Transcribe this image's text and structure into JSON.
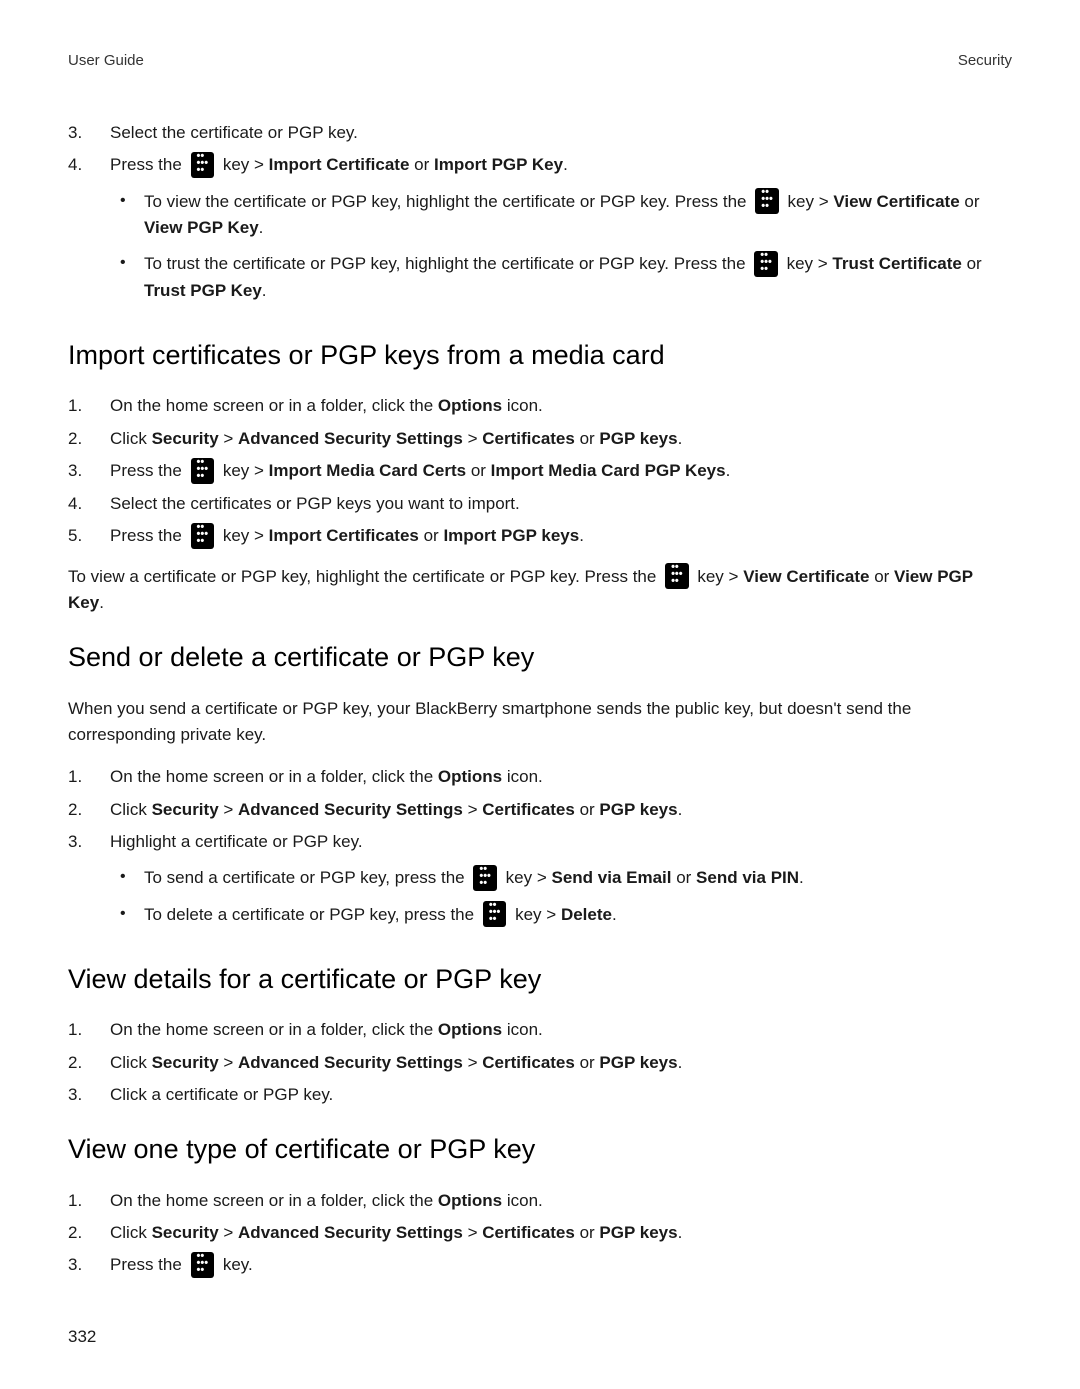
{
  "header": {
    "left": "User Guide",
    "right": "Security"
  },
  "top_steps": [
    {
      "num": "3.",
      "text": "Select the certificate or PGP key."
    },
    {
      "num": "4.",
      "parts": [
        {
          "t": "Press the "
        },
        {
          "key": true
        },
        {
          "t": "  key > "
        },
        {
          "b": "Import Certificate"
        },
        {
          "t": " or "
        },
        {
          "b": "Import PGP Key"
        },
        {
          "t": "."
        }
      ],
      "bullets": [
        [
          {
            "t": "To view the certificate or PGP key, highlight the certificate or PGP key. Press the "
          },
          {
            "key": true
          },
          {
            "t": "  key > "
          },
          {
            "b": "View Certificate"
          },
          {
            "t": " or "
          },
          {
            "b": "View PGP Key"
          },
          {
            "t": "."
          }
        ],
        [
          {
            "t": "To trust the certificate or PGP key, highlight the certificate or PGP key. Press the "
          },
          {
            "key": true
          },
          {
            "t": "  key > "
          },
          {
            "b": "Trust Certificate"
          },
          {
            "t": " or "
          },
          {
            "b": "Trust PGP Key"
          },
          {
            "t": "."
          }
        ]
      ]
    }
  ],
  "sections": [
    {
      "heading": "Import certificates or PGP keys from a media card",
      "name": "import-media-card",
      "steps": [
        {
          "num": "1.",
          "parts": [
            {
              "t": "On the home screen or in a folder, click the "
            },
            {
              "b": "Options"
            },
            {
              "t": " icon."
            }
          ]
        },
        {
          "num": "2.",
          "parts": [
            {
              "t": "Click "
            },
            {
              "b": "Security"
            },
            {
              "t": " > "
            },
            {
              "b": "Advanced Security Settings"
            },
            {
              "t": " > "
            },
            {
              "b": "Certificates"
            },
            {
              "t": " or "
            },
            {
              "b": "PGP keys"
            },
            {
              "t": "."
            }
          ]
        },
        {
          "num": "3.",
          "parts": [
            {
              "t": "Press the "
            },
            {
              "key": true
            },
            {
              "t": "  key > "
            },
            {
              "b": "Import Media Card Certs"
            },
            {
              "t": " or "
            },
            {
              "b": "Import Media Card PGP Keys"
            },
            {
              "t": "."
            }
          ]
        },
        {
          "num": "4.",
          "parts": [
            {
              "t": "Select the certificates or PGP keys you want to import."
            }
          ]
        },
        {
          "num": "5.",
          "parts": [
            {
              "t": "Press the "
            },
            {
              "key": true
            },
            {
              "t": "  key > "
            },
            {
              "b": "Import Certificates"
            },
            {
              "t": " or "
            },
            {
              "b": "Import PGP keys"
            },
            {
              "t": "."
            }
          ]
        }
      ],
      "after_para": [
        {
          "t": "To view a certificate or PGP key, highlight the certificate or PGP key. Press the "
        },
        {
          "key": true
        },
        {
          "t": "  key > "
        },
        {
          "b": "View Certificate"
        },
        {
          "t": " or "
        },
        {
          "b": "View PGP Key"
        },
        {
          "t": "."
        }
      ]
    },
    {
      "heading": "Send or delete a certificate or PGP key",
      "name": "send-delete",
      "intro": "When you send a certificate or PGP key, your BlackBerry smartphone sends the public key, but doesn't send the corresponding private key.",
      "steps": [
        {
          "num": "1.",
          "parts": [
            {
              "t": "On the home screen or in a folder, click the "
            },
            {
              "b": "Options"
            },
            {
              "t": " icon."
            }
          ]
        },
        {
          "num": "2.",
          "parts": [
            {
              "t": "Click "
            },
            {
              "b": "Security"
            },
            {
              "t": " > "
            },
            {
              "b": "Advanced Security Settings"
            },
            {
              "t": " > "
            },
            {
              "b": "Certificates"
            },
            {
              "t": " or "
            },
            {
              "b": "PGP keys"
            },
            {
              "t": "."
            }
          ]
        },
        {
          "num": "3.",
          "parts": [
            {
              "t": "Highlight a certificate or PGP key."
            }
          ],
          "bullets": [
            [
              {
                "t": "To send a certificate or PGP key, press the "
              },
              {
                "key": true
              },
              {
                "t": "  key > "
              },
              {
                "b": "Send via Email"
              },
              {
                "t": " or "
              },
              {
                "b": "Send via PIN"
              },
              {
                "t": "."
              }
            ],
            [
              {
                "t": "To delete a certificate or PGP key, press the "
              },
              {
                "key": true
              },
              {
                "t": "  key > "
              },
              {
                "b": "Delete"
              },
              {
                "t": "."
              }
            ]
          ]
        }
      ]
    },
    {
      "heading": "View details for a certificate or PGP key",
      "name": "view-details",
      "steps": [
        {
          "num": "1.",
          "parts": [
            {
              "t": "On the home screen or in a folder, click the "
            },
            {
              "b": "Options"
            },
            {
              "t": " icon."
            }
          ]
        },
        {
          "num": "2.",
          "parts": [
            {
              "t": "Click "
            },
            {
              "b": "Security"
            },
            {
              "t": " > "
            },
            {
              "b": "Advanced Security Settings"
            },
            {
              "t": " > "
            },
            {
              "b": "Certificates"
            },
            {
              "t": " or "
            },
            {
              "b": "PGP keys"
            },
            {
              "t": "."
            }
          ]
        },
        {
          "num": "3.",
          "parts": [
            {
              "t": "Click a certificate or PGP key."
            }
          ]
        }
      ]
    },
    {
      "heading": "View one type of certificate or PGP key",
      "name": "view-one-type",
      "steps": [
        {
          "num": "1.",
          "parts": [
            {
              "t": "On the home screen or in a folder, click the "
            },
            {
              "b": "Options"
            },
            {
              "t": " icon."
            }
          ]
        },
        {
          "num": "2.",
          "parts": [
            {
              "t": "Click "
            },
            {
              "b": "Security"
            },
            {
              "t": " > "
            },
            {
              "b": "Advanced Security Settings"
            },
            {
              "t": " > "
            },
            {
              "b": "Certificates"
            },
            {
              "t": " or "
            },
            {
              "b": "PGP keys"
            },
            {
              "t": "."
            }
          ]
        },
        {
          "num": "3.",
          "parts": [
            {
              "t": "Press the "
            },
            {
              "key": true
            },
            {
              "t": "  key."
            }
          ]
        }
      ]
    }
  ],
  "page_number": "332"
}
